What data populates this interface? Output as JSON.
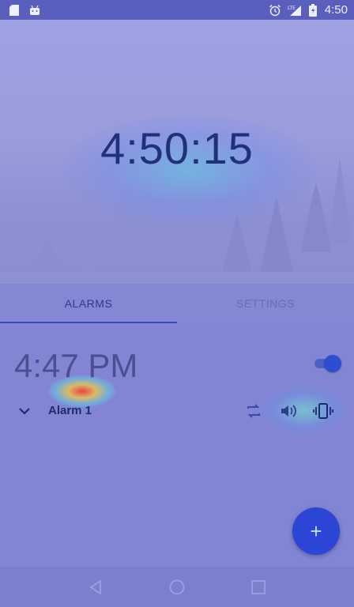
{
  "status_bar": {
    "time": "4:50",
    "network": "LTE",
    "icons": [
      "sd-card-icon",
      "android-icon",
      "alarm-clock-icon",
      "signal-icon",
      "battery-icon"
    ]
  },
  "clock": {
    "time": "4:50:15"
  },
  "tabs": [
    {
      "label": "ALARMS",
      "active": true
    },
    {
      "label": "SETTINGS",
      "active": false
    }
  ],
  "alarms": [
    {
      "time": "4:47 PM",
      "label": "Alarm 1",
      "enabled": true,
      "actions": [
        "repeat-icon",
        "sound-icon",
        "vibrate-icon"
      ]
    }
  ],
  "fab": {
    "label": "+"
  },
  "navigation": [
    "back-icon",
    "home-icon",
    "recents-icon"
  ],
  "colors": {
    "accent": "#2d45d6",
    "status_bar": "#5a5fbe",
    "background": "#8285d3"
  }
}
